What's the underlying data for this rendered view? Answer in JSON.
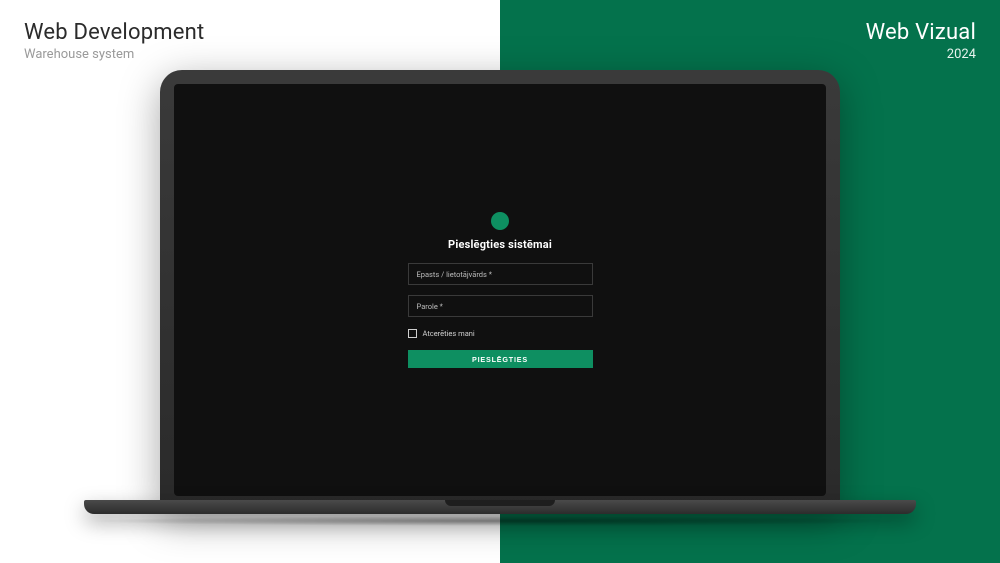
{
  "header": {
    "left_title": "Web Development",
    "left_subtitle": "Warehouse system",
    "right_title": "Web Vizual",
    "right_year": "2024"
  },
  "login": {
    "heading": "Pieslēgties sistēmai",
    "username_placeholder": "Epasts / lietotājvārds *",
    "password_placeholder": "Parole *",
    "remember_label": "Atcerēties mani",
    "submit_label": "PIESLĒGTIES"
  },
  "colors": {
    "accent": "#0e8f61",
    "brand_bg": "#04724c"
  }
}
